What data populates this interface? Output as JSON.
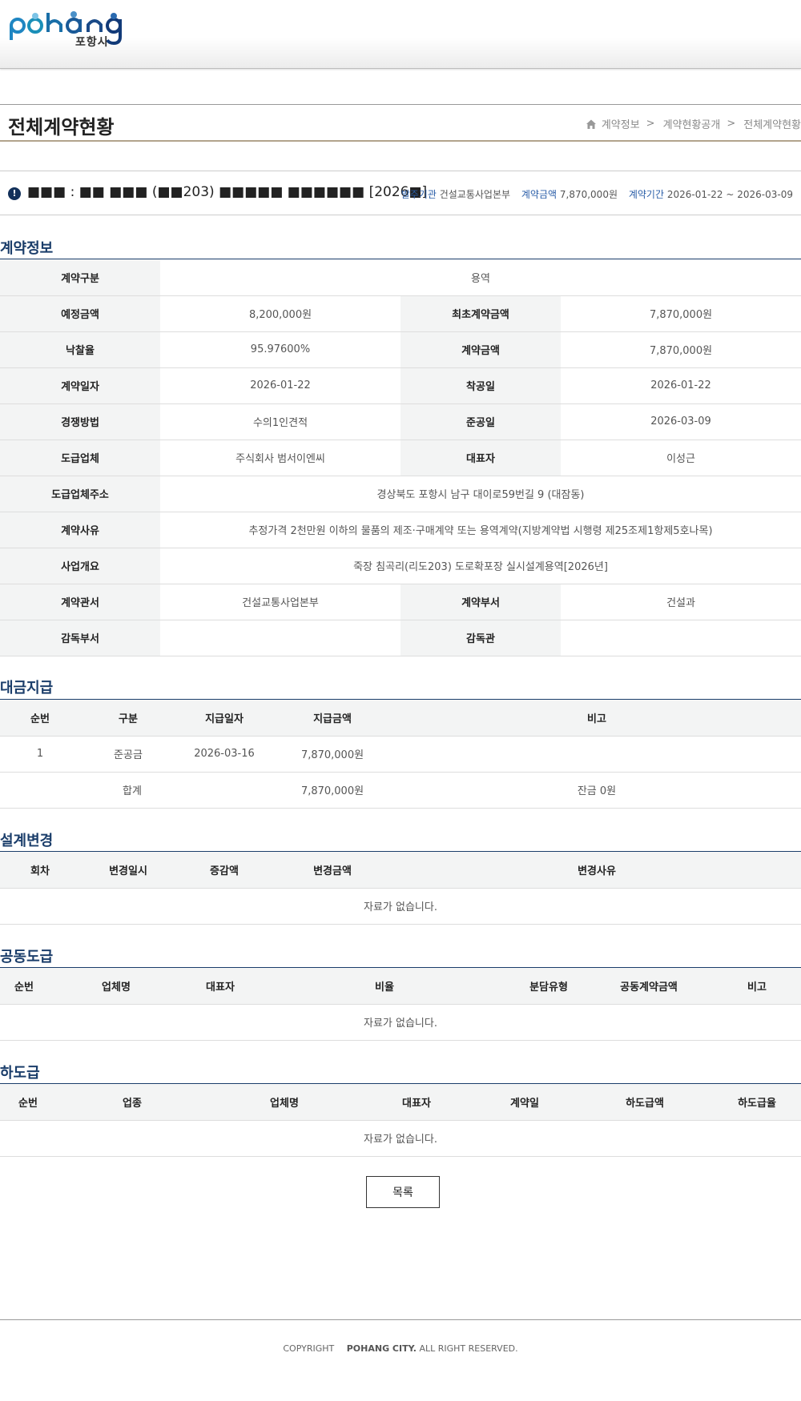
{
  "header": {
    "logo_sub": "포항시"
  },
  "title_bar": {
    "title": "전체계약현황",
    "breadcrumb": [
      "계약정보",
      "계약현황공개",
      "전체계약현황"
    ]
  },
  "summary": {
    "title": "■■■ : ■■ ■■■ (■■203) ■■■■■ ■■■■■■ [2026■]",
    "client_label": "발주기관",
    "client": "건설교통사업본부",
    "amount_label": "계약금액",
    "amount": "7,870,000원",
    "period_label": "계약기간",
    "period": "2026-01-22 ~ 2026-03-09"
  },
  "contract_info": {
    "section_title": "계약정보",
    "rows": [
      {
        "l1": "계약구분",
        "v1": "용역"
      },
      {
        "l1": "예정금액",
        "v1": "8,200,000원",
        "l2": "최초계약금액",
        "v2": "7,870,000원"
      },
      {
        "l1": "낙찰율",
        "v1": "95.97600%",
        "l2": "계약금액",
        "v2": "7,870,000원"
      },
      {
        "l1": "계약일자",
        "v1": "2026-01-22",
        "l2": "착공일",
        "v2": "2026-01-22"
      },
      {
        "l1": "경쟁방법",
        "v1": "수의1인견적",
        "l2": "준공일",
        "v2": "2026-03-09"
      },
      {
        "l1": "도급업체",
        "v1": "주식회사 범서이엔씨",
        "l2": "대표자",
        "v2": "이성근"
      },
      {
        "l1": "도급업체주소",
        "v1": "경상북도 포항시 남구 대이로59번길 9 (대잠동)"
      },
      {
        "l1": "계약사유",
        "v1": "추정가격 2천만원 이하의 물품의 제조·구매계약 또는 용역계약(지방계약법 시행령 제25조제1항제5호나목)"
      },
      {
        "l1": "사업개요",
        "v1": "죽장 침곡리(리도203) 도로확포장 실시설계용역[2026년]"
      },
      {
        "l1": "계약관서",
        "v1": "건설교통사업본부",
        "l2": "계약부서",
        "v2": "건설과"
      },
      {
        "l1": "감독부서",
        "v1": "",
        "l2": "감독관",
        "v2": ""
      }
    ]
  },
  "payment": {
    "section_title": "대금지급",
    "headers": [
      "순번",
      "구분",
      "지급일자",
      "지급금액",
      "비고"
    ],
    "rows": [
      {
        "no": "1",
        "type": "준공금",
        "date": "2026-03-16",
        "amount": "7,870,000원",
        "note": ""
      }
    ],
    "total": {
      "label": "합계",
      "amount": "7,870,000원",
      "balance": "잔금 0원"
    }
  },
  "design_change": {
    "section_title": "설계변경",
    "headers": [
      "회차",
      "변경일시",
      "증감액",
      "변경금액",
      "변경사유"
    ],
    "empty": "자료가 없습니다."
  },
  "joint_contract": {
    "section_title": "공동도급",
    "headers": [
      "순번",
      "업체명",
      "대표자",
      "비율",
      "분담유형",
      "공동계약금액",
      "비고"
    ],
    "empty": "자료가 없습니다."
  },
  "subcontract": {
    "section_title": "하도급",
    "headers": [
      "순번",
      "업종",
      "업체명",
      "대표자",
      "계약일",
      "하도급액",
      "하도급율"
    ],
    "empty": "자료가 없습니다."
  },
  "list_button": "목록",
  "footer": {
    "copyright": "COPYRIGHT",
    "brand": "POHANG CITY.",
    "rights": "ALL RIGHT RESERVED."
  },
  "colors": {
    "accent": "#1a3d6a",
    "link": "#2a5ea8",
    "label_bg": "#f3f4f4",
    "logo_blue": "#1f86c2"
  }
}
